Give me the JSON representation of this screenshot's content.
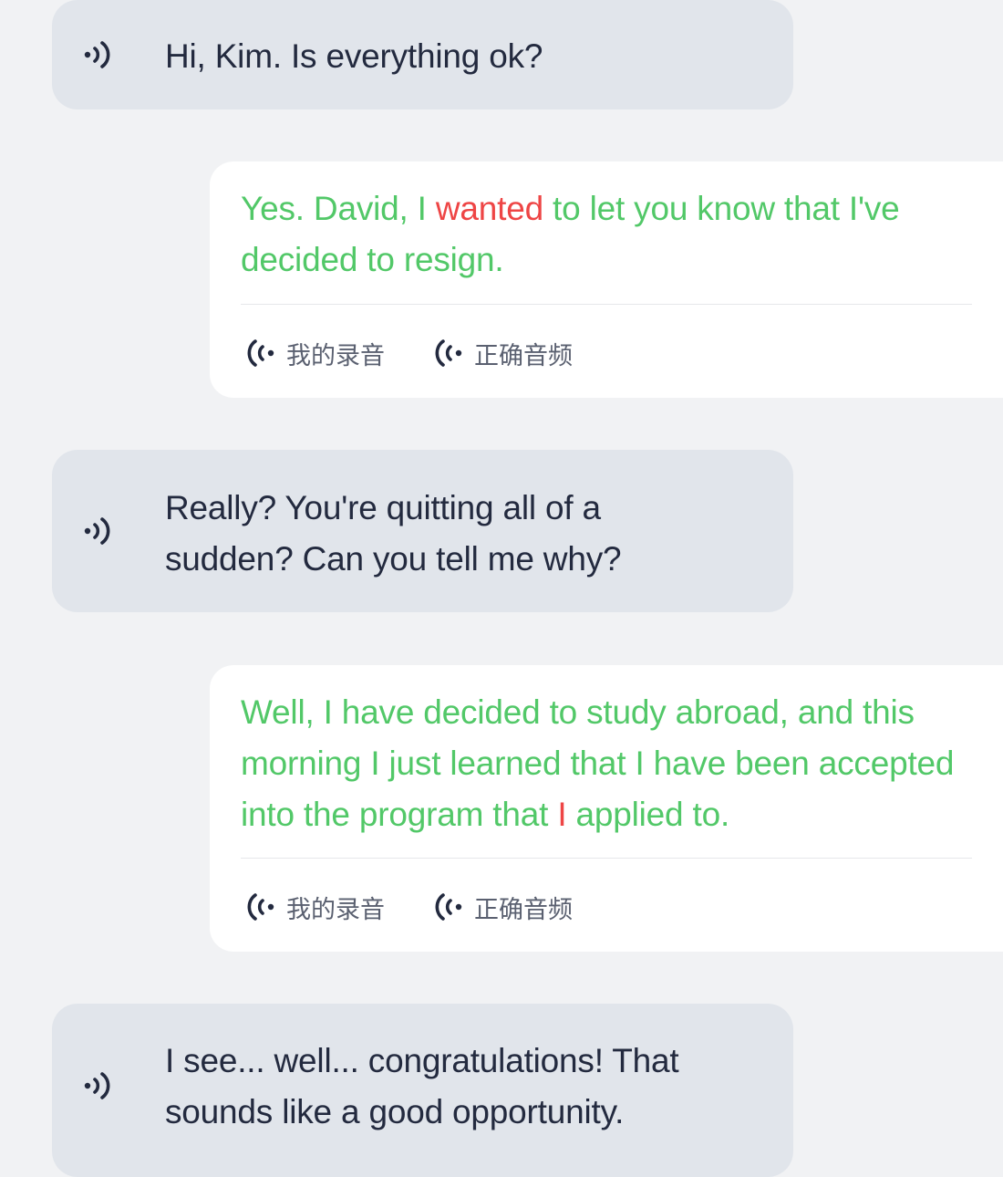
{
  "messages": [
    {
      "side": "left",
      "text": "Hi, Kim. Is everything ok?"
    },
    {
      "side": "right",
      "segments": [
        {
          "text": "Yes. David, I ",
          "status": "correct"
        },
        {
          "text": "wanted",
          "status": "wrong"
        },
        {
          "text": " to let you know that I've decided to resign.",
          "status": "correct"
        }
      ],
      "buttons": {
        "my_recording": "我的录音",
        "correct_audio": "正确音频"
      }
    },
    {
      "side": "left",
      "line1": "Really? You're quitting all of a",
      "line2": "sudden? Can you tell me why?"
    },
    {
      "side": "right",
      "segments": [
        {
          "text": "Well, I have decided to study abroad, and this morning I just learned that I have been accepted into the program that ",
          "status": "correct"
        },
        {
          "text": "I",
          "status": "wrong"
        },
        {
          "text": " applied to.",
          "status": "correct"
        }
      ],
      "buttons": {
        "my_recording": "我的录音",
        "correct_audio": "正确音频"
      }
    },
    {
      "side": "left",
      "line1": "I see... well... congratulations! That",
      "line2": "sounds like a good opportunity."
    }
  ],
  "colors": {
    "correct": "#52c868",
    "wrong": "#ee4545",
    "text_dark": "#232a3f",
    "left_bubble": "#e1e5eb",
    "right_bubble": "#ffffff",
    "background": "#f1f2f4"
  },
  "icons": {
    "prompt_audio": "speaker-icon",
    "recording_audio": "audio-wave-icon"
  }
}
